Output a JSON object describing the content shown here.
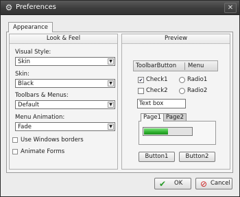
{
  "window": {
    "title": "Preferences",
    "close_glyph": "✕",
    "icon": "gear-icon"
  },
  "tabs": [
    {
      "label": "Appearance"
    }
  ],
  "look_feel": {
    "header": "Look & Feel",
    "visual_style": {
      "label": "Visual Style:",
      "value": "Skin"
    },
    "skin": {
      "label": "Skin:",
      "value": "Black"
    },
    "toolbars_menus": {
      "label": "Toolbars & Menus:",
      "value": "Default"
    },
    "menu_animation": {
      "label": "Menu Animation:",
      "value": "Fade"
    },
    "use_windows_borders": {
      "label": "Use Windows borders",
      "checked": false
    },
    "animate_forms": {
      "label": "Animate Forms",
      "checked": false
    }
  },
  "preview": {
    "header": "Preview",
    "toolbar": {
      "button": "ToolbarButton",
      "menu": "Menu"
    },
    "check1": {
      "label": "Check1",
      "checked": true
    },
    "radio1": {
      "label": "Radio1",
      "selected": false
    },
    "check2": {
      "label": "Check2",
      "checked": false
    },
    "radio2": {
      "label": "Radio2",
      "selected": false
    },
    "textbox": {
      "value": "Text box"
    },
    "pages": [
      {
        "label": "Page1"
      },
      {
        "label": "Page2"
      }
    ],
    "progress": {
      "value": 0.5
    },
    "button1": "Button1",
    "button2": "Button2"
  },
  "footer": {
    "ok_label": "OK",
    "cancel_label": "Cancel"
  },
  "colors": {
    "title_bar": "#3d3d3d",
    "progress_fill": "#2fb12f",
    "ok_icon": "#2a9b2a",
    "cancel_icon": "#cc2222"
  }
}
